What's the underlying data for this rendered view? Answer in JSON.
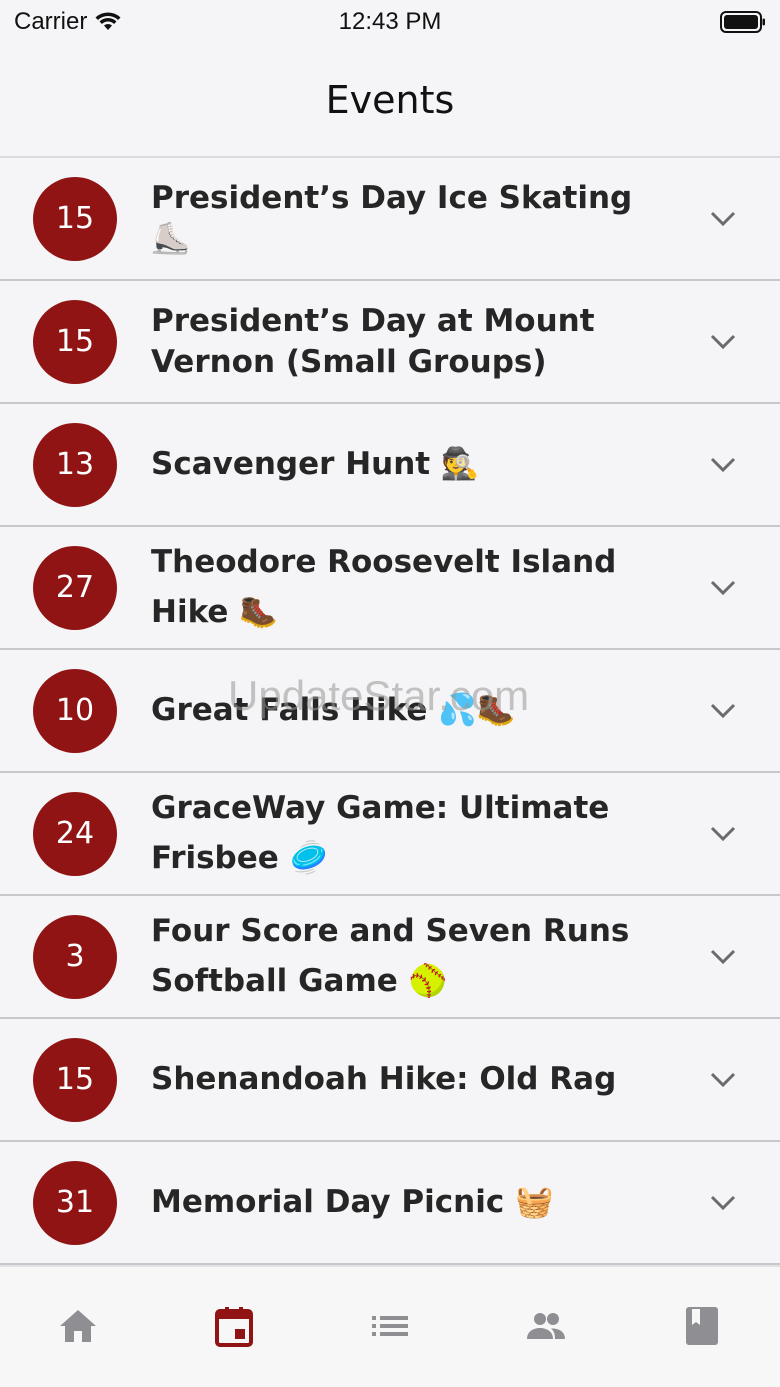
{
  "status_bar": {
    "carrier": "Carrier",
    "time": "12:43 PM"
  },
  "header": {
    "title": "Events"
  },
  "events": [
    {
      "day": "15",
      "title": "President’s Day Ice Skating ⛸️"
    },
    {
      "day": "15",
      "title": "President’s Day at Mount Vernon (Small Groups)"
    },
    {
      "day": "13",
      "title": "Scavenger Hunt 🕵️"
    },
    {
      "day": "27",
      "title": "Theodore Roosevelt Island Hike 🥾"
    },
    {
      "day": "10",
      "title": "Great Falls Hike 💦🥾"
    },
    {
      "day": "24",
      "title": "GraceWay Game: Ultimate Frisbee 🥏"
    },
    {
      "day": "3",
      "title": "Four Score and Seven Runs Softball Game 🥎"
    },
    {
      "day": "15",
      "title": "Shenandoah Hike: Old Rag"
    },
    {
      "day": "31",
      "title": "Memorial Day Picnic 🧺"
    }
  ],
  "tab_bar": {
    "tabs": [
      {
        "icon": "home-icon",
        "active": false
      },
      {
        "icon": "calendar-icon",
        "active": true
      },
      {
        "icon": "list-icon",
        "active": false
      },
      {
        "icon": "people-icon",
        "active": false
      },
      {
        "icon": "book-icon",
        "active": false
      }
    ]
  },
  "watermark": "UpdateStar.com",
  "colors": {
    "accent": "#901414",
    "inactive_icon": "#8e8e93"
  }
}
